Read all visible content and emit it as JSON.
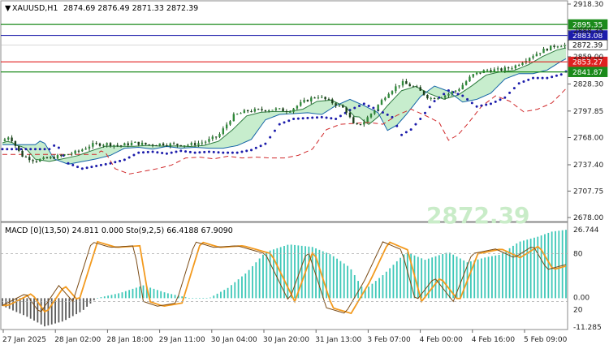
{
  "header": {
    "symbol": "XAUUSD,H1",
    "ohlc": "2874.69 2876.49 2871.33 2872.39"
  },
  "price_axis": {
    "ticks": [
      "2918.30",
      "2888.35",
      "2859.00",
      "2828.30",
      "2797.85",
      "2768.00",
      "2737.40",
      "2707.75",
      "2678.00"
    ],
    "tags": [
      {
        "value": 2895.35,
        "label": "2895.35",
        "color": "#1a8a1a",
        "kind": "support-resistance-line"
      },
      {
        "value": 2883.08,
        "label": "2883.08",
        "color": "#1c1cab",
        "kind": "horizontal-line"
      },
      {
        "value": 2872.39,
        "label": "2872.39",
        "color": "#ffffff",
        "kind": "last-price"
      },
      {
        "value": 2853.27,
        "label": "2853.27",
        "color": "#e02020",
        "kind": "horizontal-line"
      },
      {
        "value": 2841.87,
        "label": "2841.87",
        "color": "#1a8a1a",
        "kind": "support-resistance-line"
      }
    ]
  },
  "macd_panel": {
    "label": "MACD [0](13,50) 24.811 0.000   Sto(9,2,5) 66.4188 67.9090",
    "ticks": [
      "26.744",
      "80",
      "0.00",
      "20",
      "-11.285"
    ],
    "watermark": "2872.39",
    "colors": {
      "histogram_positive": "#3ec8b8",
      "histogram_negative": "#5a5a5a",
      "stoch_main": "#7a4a14",
      "stoch_signal": "#f39a1e"
    }
  },
  "time_axis": {
    "labels": [
      "27 Jan 2025",
      "28 Jan 02:00",
      "28 Jan 18:00",
      "29 Jan 11:00",
      "30 Jan 04:00",
      "30 Jan 20:00",
      "31 Jan 13:00",
      "3 Feb 07:00",
      "4 Feb 00:00",
      "4 Feb 16:00",
      "5 Feb 09:00"
    ]
  },
  "chart_data": [
    {
      "type": "candlestick",
      "title": "XAUUSD,H1",
      "y_range": [
        2678.0,
        2918.3
      ],
      "x_labels": [
        "27 Jan 2025",
        "28 Jan 02:00",
        "28 Jan 18:00",
        "29 Jan 11:00",
        "30 Jan 04:00",
        "30 Jan 20:00",
        "31 Jan 13:00",
        "3 Feb 07:00",
        "4 Feb 00:00",
        "4 Feb 16:00",
        "5 Feb 09:00"
      ],
      "close_path": [
        [
          0,
          2764
        ],
        [
          3,
          2770
        ],
        [
          8,
          2748
        ],
        [
          14,
          2742
        ],
        [
          20,
          2745
        ],
        [
          26,
          2748
        ],
        [
          32,
          2752
        ],
        [
          38,
          2760
        ],
        [
          44,
          2761
        ],
        [
          50,
          2759
        ],
        [
          56,
          2762
        ],
        [
          62,
          2760
        ],
        [
          68,
          2761
        ],
        [
          74,
          2760
        ],
        [
          80,
          2760
        ],
        [
          86,
          2763
        ],
        [
          92,
          2770
        ],
        [
          98,
          2792
        ],
        [
          104,
          2798
        ],
        [
          110,
          2799
        ],
        [
          116,
          2800
        ],
        [
          122,
          2798
        ],
        [
          128,
          2808
        ],
        [
          134,
          2815
        ],
        [
          140,
          2808
        ],
        [
          146,
          2800
        ],
        [
          150,
          2780
        ],
        [
          154,
          2786
        ],
        [
          158,
          2798
        ],
        [
          164,
          2818
        ],
        [
          170,
          2830
        ],
        [
          176,
          2824
        ],
        [
          182,
          2812
        ],
        [
          188,
          2815
        ],
        [
          194,
          2822
        ],
        [
          200,
          2838
        ],
        [
          206,
          2844
        ],
        [
          212,
          2844
        ],
        [
          218,
          2848
        ],
        [
          224,
          2858
        ],
        [
          230,
          2866
        ],
        [
          236,
          2872
        ],
        [
          240,
          2872.39
        ]
      ],
      "highs": [
        2918.3,
        2886
      ],
      "series": [
        {
          "name": "MA fast (green cloud edge)",
          "style": "line"
        },
        {
          "name": "MA slow (blue dotted)",
          "style": "dots"
        },
        {
          "name": "MA long (red dashed)",
          "style": "dashed"
        }
      ],
      "horizontal_lines": [
        2895.35,
        2883.08,
        2872.39,
        2853.27,
        2841.87
      ]
    },
    {
      "type": "bar",
      "title": "MACD [0](13,50) / Sto(9,2,5)",
      "y_range": [
        -11.285,
        26.744
      ],
      "macd": 24.811,
      "signal": 0.0,
      "stoch_main": 66.4188,
      "stoch_signal": 67.909,
      "histogram_path": [
        [
          0,
          -3
        ],
        [
          10,
          -7
        ],
        [
          18,
          -11
        ],
        [
          26,
          -9
        ],
        [
          34,
          -5
        ],
        [
          40,
          0
        ],
        [
          50,
          2
        ],
        [
          60,
          5
        ],
        [
          70,
          2
        ],
        [
          80,
          0
        ],
        [
          88,
          0
        ],
        [
          96,
          4
        ],
        [
          104,
          10
        ],
        [
          112,
          18
        ],
        [
          122,
          21
        ],
        [
          132,
          20
        ],
        [
          140,
          17
        ],
        [
          148,
          12
        ],
        [
          154,
          3
        ],
        [
          162,
          9
        ],
        [
          172,
          18
        ],
        [
          180,
          15
        ],
        [
          190,
          18
        ],
        [
          198,
          14
        ],
        [
          206,
          16
        ],
        [
          212,
          17
        ],
        [
          220,
          22
        ],
        [
          228,
          24
        ],
        [
          234,
          26
        ],
        [
          240,
          26.7
        ]
      ],
      "stoch_path": [
        [
          0,
          15
        ],
        [
          10,
          30
        ],
        [
          16,
          5
        ],
        [
          24,
          40
        ],
        [
          30,
          20
        ],
        [
          38,
          95
        ],
        [
          46,
          88
        ],
        [
          56,
          90
        ],
        [
          60,
          20
        ],
        [
          66,
          14
        ],
        [
          70,
          16
        ],
        [
          74,
          18
        ],
        [
          82,
          95
        ],
        [
          90,
          88
        ],
        [
          100,
          90
        ],
        [
          112,
          80
        ],
        [
          122,
          20
        ],
        [
          130,
          85
        ],
        [
          138,
          12
        ],
        [
          146,
          5
        ],
        [
          154,
          45
        ],
        [
          162,
          95
        ],
        [
          170,
          85
        ],
        [
          176,
          20
        ],
        [
          184,
          50
        ],
        [
          192,
          20
        ],
        [
          200,
          80
        ],
        [
          210,
          86
        ],
        [
          218,
          75
        ],
        [
          226,
          90
        ],
        [
          232,
          60
        ],
        [
          240,
          66.4
        ]
      ]
    }
  ]
}
